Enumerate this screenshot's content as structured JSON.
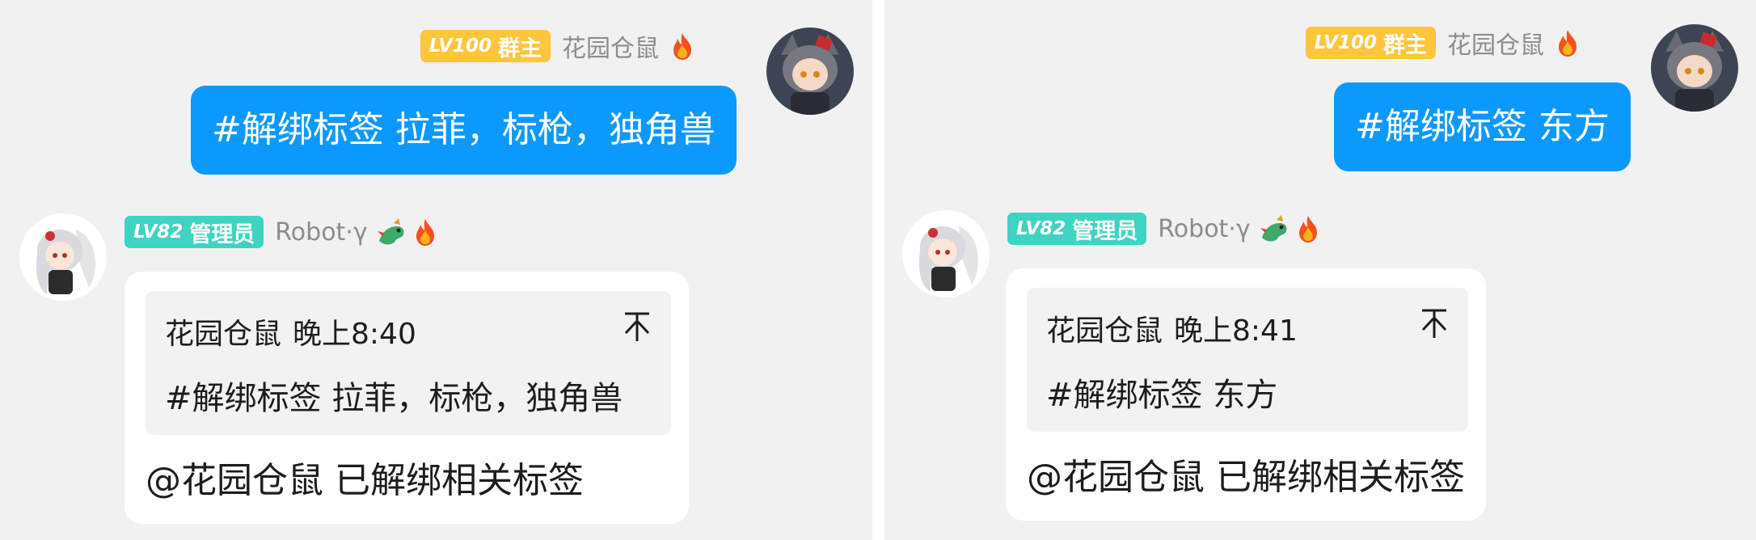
{
  "panels": [
    {
      "sender": {
        "badge_level": "LV100",
        "badge_role": "群主",
        "nickname": "花园仓鼠",
        "emoji": "fire-icon",
        "message": "#解绑标签 拉菲，标枪，独角兽"
      },
      "bot": {
        "badge_level": "LV82",
        "badge_role": "管理员",
        "nickname": "Robot·γ",
        "emojis": [
          "dragon-icon",
          "fire-icon"
        ],
        "quote_author": "花园仓鼠",
        "quote_time": "晚上8:40",
        "quote_text": "#解绑标签 拉菲，标枪，独角兽",
        "reply": "@花园仓鼠 已解绑相关标签"
      }
    },
    {
      "sender": {
        "badge_level": "LV100",
        "badge_role": "群主",
        "nickname": "花园仓鼠",
        "emoji": "fire-icon",
        "message": "#解绑标签 东方"
      },
      "bot": {
        "badge_level": "LV82",
        "badge_role": "管理员",
        "nickname": "Robot·γ",
        "emojis": [
          "dragon-icon",
          "fire-icon"
        ],
        "quote_author": "花园仓鼠",
        "quote_time": "晚上8:41",
        "quote_text": "#解绑标签 东方",
        "reply": "@花园仓鼠 已解绑相关标签"
      }
    }
  ],
  "colors": {
    "background": "#f1f1f1",
    "sender_bubble": "#0c99ff",
    "owner_badge": "#ffc53d",
    "admin_badge": "#3fd3c1",
    "nickname": "#8c8c8c"
  }
}
